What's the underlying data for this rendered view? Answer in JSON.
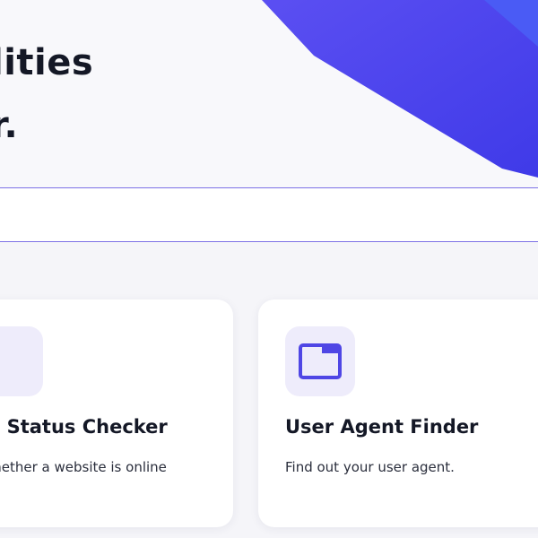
{
  "hero": {
    "heading_line1": "lities",
    "heading_line2": "r."
  },
  "search": {
    "value": ""
  },
  "cards": [
    {
      "title": "te Status Checker",
      "description": "whether a website is online",
      "icon": "status-checker-icon"
    },
    {
      "title": "User Agent Finder",
      "description": "Find out your user agent.",
      "icon": "browser-window-icon"
    }
  ],
  "colors": {
    "accent": "#4f46e5",
    "accent_light": "#eeecfb",
    "heading": "#141826",
    "divider": "#7d71e6"
  }
}
